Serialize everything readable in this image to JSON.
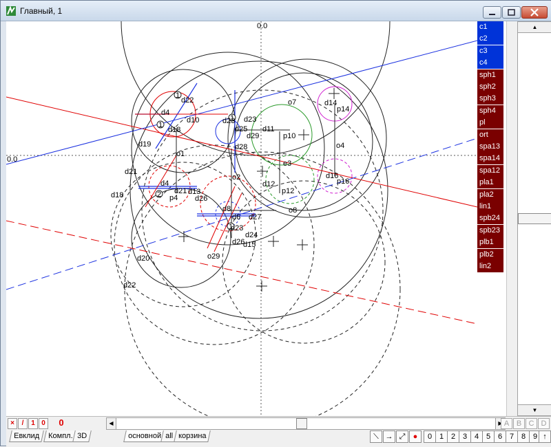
{
  "window": {
    "title": "Главный, 1"
  },
  "object_list": {
    "items": [
      {
        "label": "c1",
        "color": "blue"
      },
      {
        "label": "c2",
        "color": "blue"
      },
      {
        "label": "c3",
        "color": "blue"
      },
      {
        "label": "c4",
        "color": "blue"
      },
      {
        "label": "sph1",
        "color": "red"
      },
      {
        "label": "sph2",
        "color": "red"
      },
      {
        "label": "sph3",
        "color": "red"
      },
      {
        "label": "sph4",
        "color": "red"
      },
      {
        "label": "pl",
        "color": "red"
      },
      {
        "label": "ort",
        "color": "red"
      },
      {
        "label": "spa13",
        "color": "red"
      },
      {
        "label": "spa14",
        "color": "red"
      },
      {
        "label": "spa12",
        "color": "red"
      },
      {
        "label": "pla1",
        "color": "red"
      },
      {
        "label": "pla2",
        "color": "red"
      },
      {
        "label": "lin1",
        "color": "red"
      },
      {
        "label": "spb24",
        "color": "red"
      },
      {
        "label": "spb23",
        "color": "red"
      },
      {
        "label": "plb1",
        "color": "red"
      },
      {
        "label": "plb2",
        "color": "red"
      },
      {
        "label": "lin2",
        "color": "red"
      }
    ],
    "colors": {
      "blue": "#0033d8",
      "red": "#7a0000"
    }
  },
  "canvas": {
    "axis_labels": {
      "top": "0.0",
      "left": "0.0"
    },
    "labels": [
      "d22",
      "d4",
      "d18",
      "d10",
      "d19",
      "o1",
      "d21",
      "d4",
      "p4",
      "d13",
      "d23",
      "d25",
      "d28",
      "d29",
      "d11",
      "p10",
      "d23",
      "o7",
      "d14",
      "p14",
      "o4",
      "e3",
      "d16",
      "p16",
      "d12",
      "p12",
      "d21",
      "d18",
      "o2",
      "o8",
      "d8",
      "d6",
      "d27",
      "d23",
      "d24",
      "d26",
      "d20",
      "o29",
      "d22",
      "d15",
      "d26"
    ],
    "point_markers": [
      "1",
      "1",
      "1",
      "2",
      "1"
    ]
  },
  "status_toolbar": {
    "buttons": [
      "×",
      "/",
      "1",
      "0",
      "0"
    ],
    "abcd_buttons": [
      "A",
      "B",
      "C",
      "D"
    ]
  },
  "tabs": {
    "mode_tabs": [
      "Евклид",
      "Компл.",
      "3D"
    ],
    "layer_tabs": [
      "основной",
      "all",
      "корзина"
    ]
  },
  "bottom_toolbar": {
    "tools": [
      "⟍",
      "→",
      "⤢",
      "●"
    ],
    "digits": [
      "0",
      "1",
      "2",
      "3",
      "4",
      "5",
      "6",
      "7",
      "8",
      "9",
      "↑"
    ]
  }
}
